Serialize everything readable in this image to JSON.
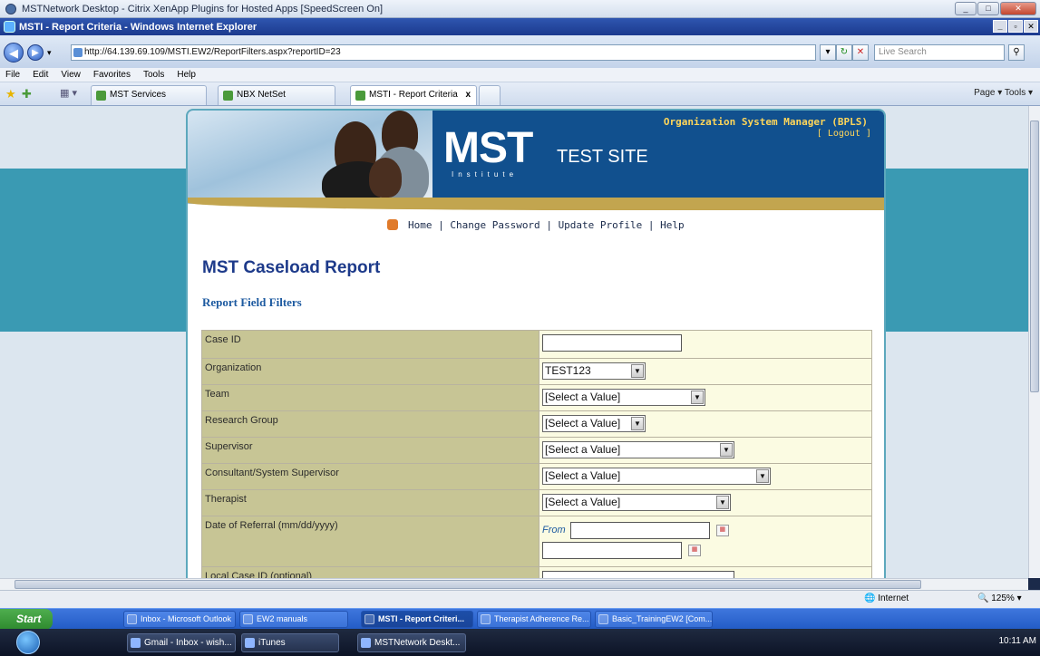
{
  "citrix_window": {
    "title": "MSTNetwork Desktop - Citrix XenApp Plugins for Hosted Apps [SpeedScreen On]"
  },
  "ie": {
    "title": "MSTI - Report Criteria - Windows Internet Explorer",
    "address": "http://64.139.69.109/MSTI.EW2/ReportFilters.aspx?reportID=23",
    "search_placeholder": "Live Search",
    "menu": [
      "File",
      "Edit",
      "View",
      "Favorites",
      "Tools",
      "Help"
    ],
    "tabs": [
      {
        "label": "MST Services"
      },
      {
        "label": "NBX NetSet"
      },
      {
        "label": "MSTI - Report Criteria",
        "close": "x"
      }
    ],
    "right_tools": "Page ▾  Tools ▾",
    "status": {
      "zone": "Internet",
      "zoom": "125%"
    }
  },
  "page": {
    "header": {
      "org_label": "Organization System Manager (BPLS)",
      "logout": "[ Logout ]",
      "logo": "MST",
      "logo_sub": "Institute",
      "site_label": "TEST SITE"
    },
    "nav": {
      "home": "Home",
      "sep": "|",
      "change_password": "Change Password",
      "update_profile": "Update Profile",
      "help": "Help"
    },
    "title": "MST Caseload Report",
    "subtitle": "Report Field Filters",
    "filters": [
      {
        "label": "Case ID",
        "type": "text",
        "value": ""
      },
      {
        "label": "Organization",
        "type": "select",
        "value": "TEST123"
      },
      {
        "label": "Team",
        "type": "select",
        "value": "[Select a Value]"
      },
      {
        "label": "Research Group",
        "type": "select",
        "value": "[Select a Value]"
      },
      {
        "label": "Supervisor",
        "type": "select",
        "value": "[Select a Value]"
      },
      {
        "label": "Consultant/System Supervisor",
        "type": "select",
        "value": "[Select a Value]"
      },
      {
        "label": "Therapist",
        "type": "select",
        "value": "[Select a Value]"
      },
      {
        "label": "Date of Referral (mm/dd/yyyy)",
        "type": "daterange",
        "from_label": "From",
        "value": ""
      },
      {
        "label": "Local Case ID (optional)",
        "type": "text",
        "value": ""
      }
    ]
  },
  "taskbar": {
    "start": "Start",
    "items": [
      {
        "label": "Inbox - Microsoft Outlook"
      },
      {
        "label": "EW2 manuals"
      },
      {
        "label": "MSTI - Report Criteri...",
        "active": true
      },
      {
        "label": "Therapist Adherence Re..."
      },
      {
        "label": "Basic_TrainingEW2 [Com..."
      }
    ]
  },
  "outer_taskbar": {
    "items": [
      {
        "label": "Gmail - Inbox - wish..."
      },
      {
        "label": "iTunes"
      },
      {
        "label": "MSTNetwork Deskt..."
      }
    ],
    "clock": "10:11 AM"
  }
}
